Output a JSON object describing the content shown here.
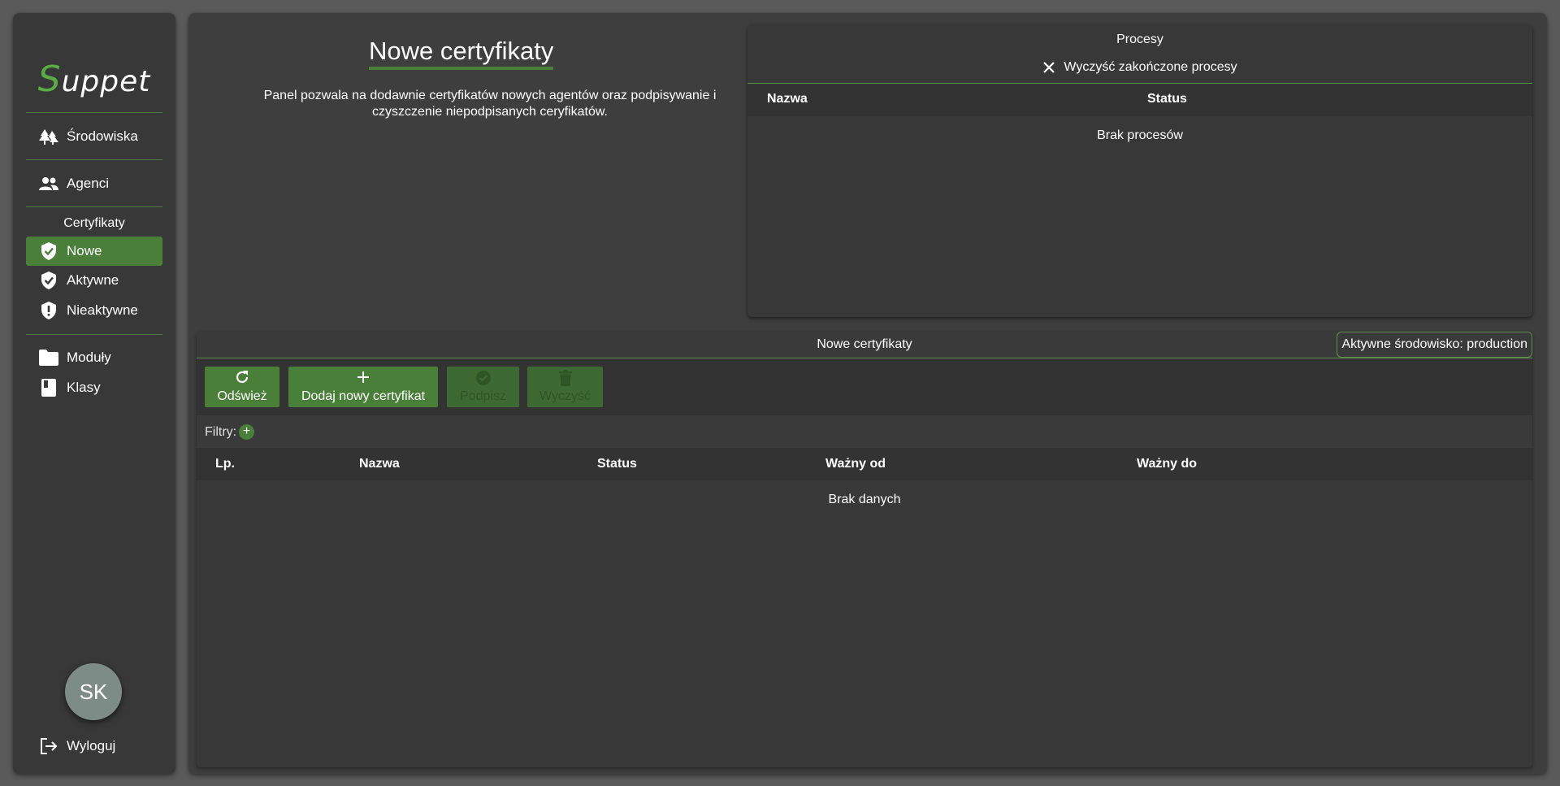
{
  "app": {
    "logo_first": "S",
    "logo_rest": "uppet"
  },
  "sidebar": {
    "items": [
      {
        "label": "Środowiska",
        "icon": "forest-icon"
      },
      {
        "label": "Agenci",
        "icon": "people-icon"
      }
    ],
    "cert_section_title": "Certyfikaty",
    "cert_items": [
      {
        "label": "Nowe",
        "icon": "shield-check-icon",
        "active": true
      },
      {
        "label": "Aktywne",
        "icon": "shield-check-icon"
      },
      {
        "label": "Nieaktywne",
        "icon": "shield-alert-icon"
      }
    ],
    "other_items": [
      {
        "label": "Moduły",
        "icon": "folder-icon"
      },
      {
        "label": "Klasy",
        "icon": "book-icon"
      }
    ],
    "avatar_initials": "SK",
    "logout_label": "Wyloguj"
  },
  "page": {
    "title": "Nowe certyfikaty",
    "description": "Panel pozwala na dodawnie certyfikatów nowych agentów oraz podpisywanie i czyszczenie niepodpisanych ceryfikatów."
  },
  "processes": {
    "title": "Procesy",
    "clear_label": "Wyczyść zakończone procesy",
    "columns": [
      "Nazwa",
      "Status"
    ],
    "empty_text": "Brak procesów"
  },
  "certificates": {
    "title": "Nowe certyfikaty",
    "env_badge": "Aktywne środowisko: production",
    "toolbar": {
      "refresh_label": "Odśwież",
      "add_label": "Dodaj nowy certyfikat",
      "sign_label": "Podpisz",
      "clear_label": "Wyczyść"
    },
    "filters_label": "Filtry:",
    "columns": [
      "Lp.",
      "Nazwa",
      "Status",
      "Ważny od",
      "Ważny do"
    ],
    "empty_text": "Brak danych"
  },
  "colors": {
    "accent": "#4a7f3a",
    "background": "#5a5a5a",
    "panel": "#3e3e3e"
  }
}
